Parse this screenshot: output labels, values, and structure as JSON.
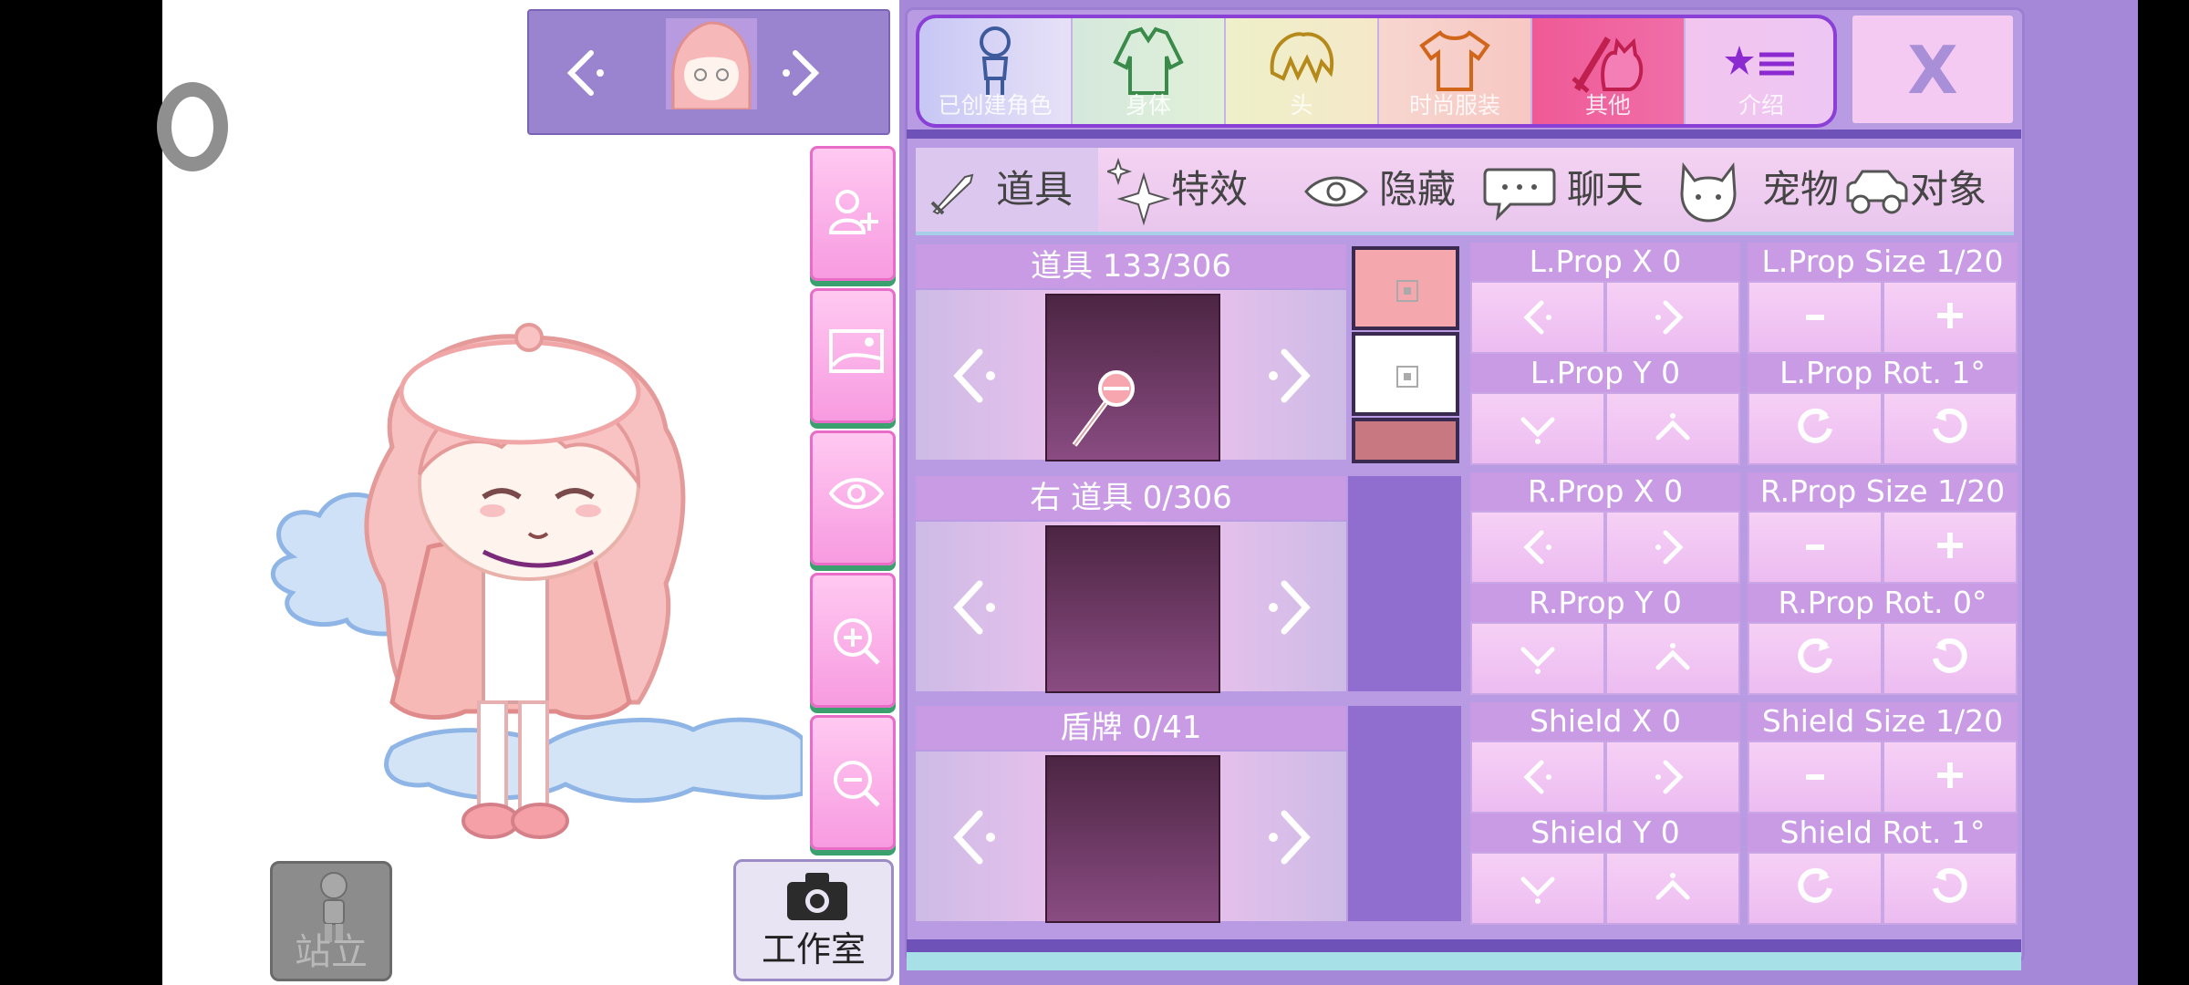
{
  "top_tabs": [
    {
      "label": "已创建角色",
      "icon": "character-outline-icon"
    },
    {
      "label": "身体",
      "icon": "jacket-icon"
    },
    {
      "label": "头",
      "icon": "hair-icon"
    },
    {
      "label": "时尚服装",
      "icon": "shirt-icon"
    },
    {
      "label": "其他",
      "icon": "sword-cat-icon",
      "active": true
    },
    {
      "label": "介绍",
      "icon": "star-list-icon"
    }
  ],
  "close_label": "X",
  "sub_tabs": [
    {
      "label": "道具",
      "icon": "sword-icon",
      "active": true
    },
    {
      "label": "特效",
      "icon": "sparkle-icon"
    },
    {
      "label": "隐藏",
      "icon": "eye-icon"
    },
    {
      "label": "聊天",
      "icon": "chat-bubble-icon"
    },
    {
      "label": "宠物",
      "icon": "cat-icon"
    },
    {
      "label": "对象",
      "icon": "car-icon"
    }
  ],
  "slots": [
    {
      "title": "道具 133/306"
    },
    {
      "title": "右 道具 0/306"
    },
    {
      "title": "盾牌 0/41"
    }
  ],
  "controls": {
    "lprop_x": "L.Prop X 0",
    "lprop_size": "L.Prop Size 1/20",
    "lprop_y": "L.Prop Y 0",
    "lprop_rot": "L.Prop Rot. 1°",
    "rprop_x": "R.Prop X 0",
    "rprop_size": "R.Prop Size 1/20",
    "rprop_y": "R.Prop Y 0",
    "rprop_rot": "R.Prop Rot. 0°",
    "shield_x": "Shield X 0",
    "shield_size": "Shield Size 1/20",
    "shield_y": "Shield Y 0",
    "shield_rot": "Shield Rot. 1°",
    "minus": "-",
    "plus": "+"
  },
  "swatch_colors": [
    "#f4a8ae",
    "#ffffff",
    "#c77880"
  ],
  "buttons": {
    "stand_label": "站立",
    "studio_label": "工作室"
  },
  "colors": {
    "panel": "#b99be3",
    "accent_pink": "#f79be0",
    "active_tab": "#ee4f98"
  }
}
